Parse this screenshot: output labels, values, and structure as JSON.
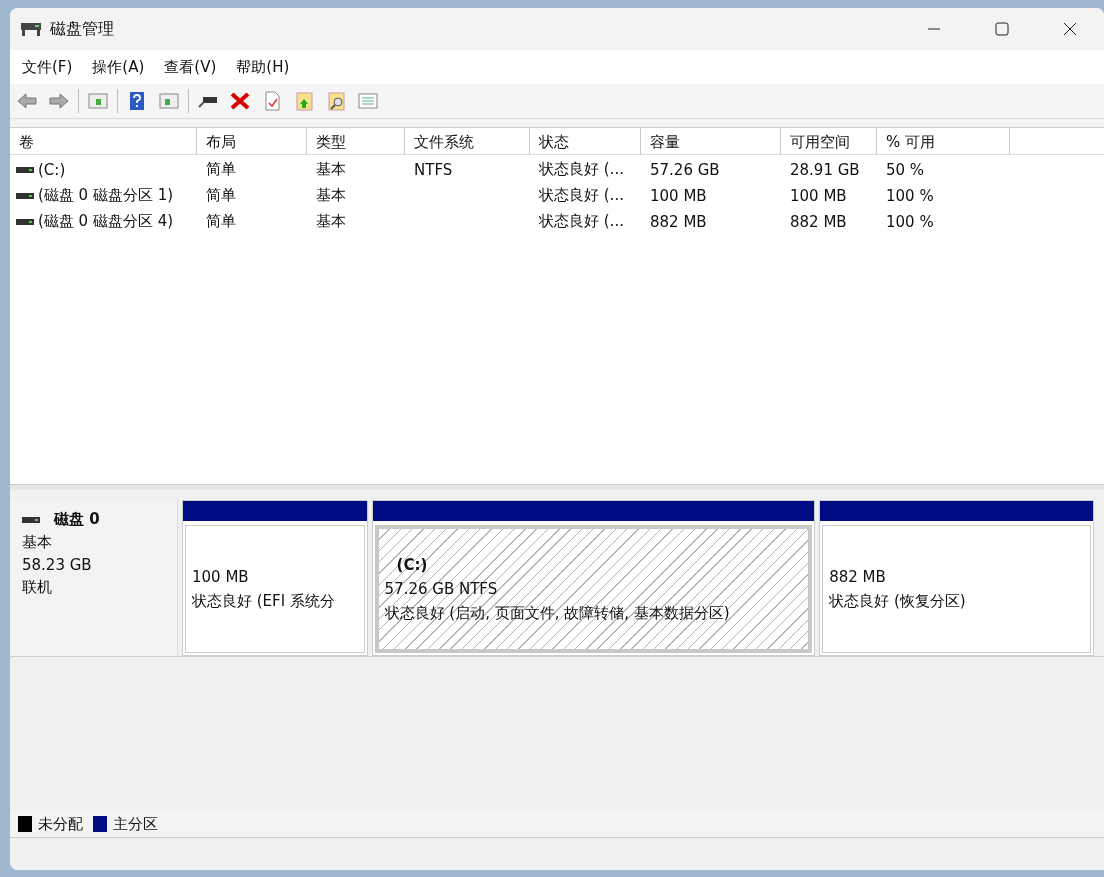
{
  "window": {
    "title": "磁盘管理"
  },
  "menu": [
    "文件(F)",
    "操作(A)",
    "查看(V)",
    "帮助(H)"
  ],
  "table": {
    "columns": [
      "卷",
      "布局",
      "类型",
      "文件系统",
      "状态",
      "容量",
      "可用空间",
      "% 可用"
    ],
    "rows": [
      [
        "(C:)",
        "简单",
        "基本",
        "NTFS",
        "状态良好 (...",
        "57.26 GB",
        "28.91 GB",
        "50 %"
      ],
      [
        "(磁盘 0 磁盘分区 1)",
        "简单",
        "基本",
        "",
        "状态良好 (...",
        "100 MB",
        "100 MB",
        "100 %"
      ],
      [
        "(磁盘 0 磁盘分区 4)",
        "简单",
        "基本",
        "",
        "状态良好 (...",
        "882 MB",
        "882 MB",
        "100 %"
      ]
    ]
  },
  "disk": {
    "name": "磁盘 0",
    "type": "基本",
    "size": "58.23 GB",
    "status": "联机",
    "partitions": [
      {
        "size": "100 MB",
        "status": "状态良好 (EFI 系统分",
        "selected": false
      },
      {
        "label": "(C:)",
        "size": "57.26 GB NTFS",
        "status": "状态良好 (启动, 页面文件, 故障转储, 基本数据分区)",
        "selected": true
      },
      {
        "size": "882 MB",
        "status": "状态良好 (恢复分区)",
        "selected": false
      }
    ]
  },
  "legend": [
    {
      "label": "未分配",
      "color": "#000000"
    },
    {
      "label": "主分区",
      "color": "#000c84"
    }
  ]
}
